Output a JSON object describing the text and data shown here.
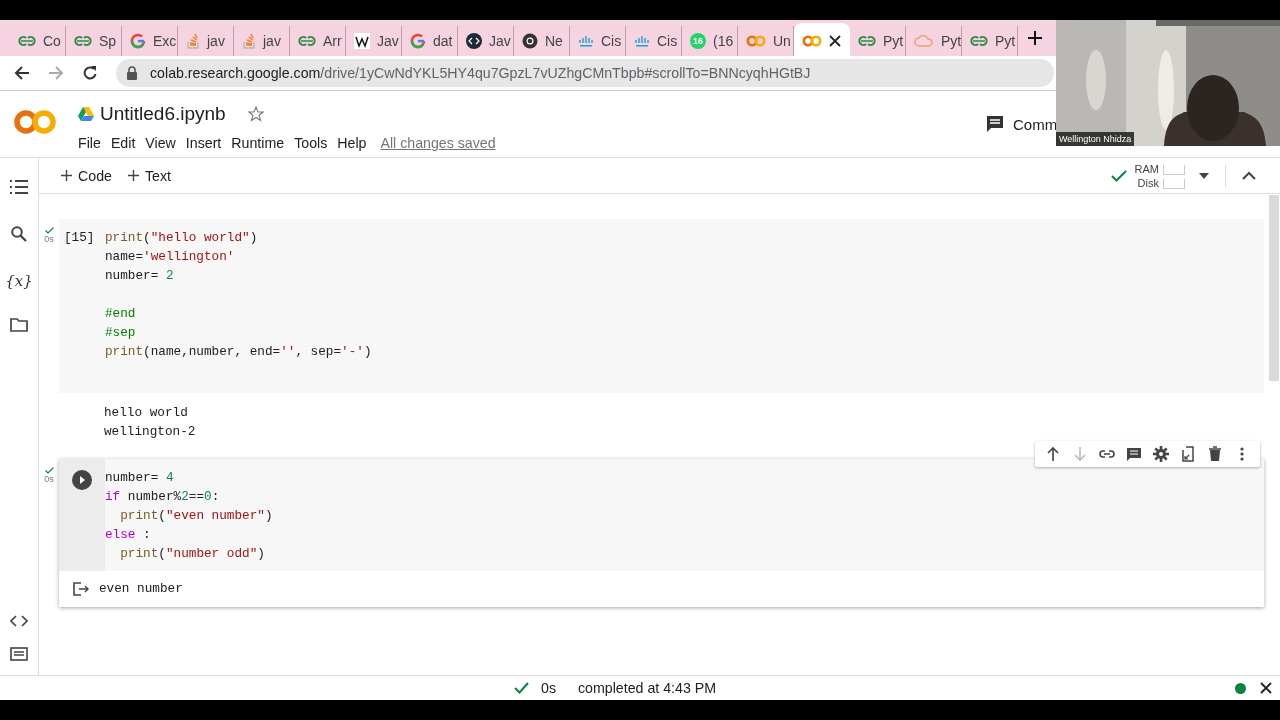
{
  "browser": {
    "tabs": [
      {
        "kind": "gfg",
        "label": "Co",
        "selected": false
      },
      {
        "kind": "gfg",
        "label": "Sp",
        "selected": false
      },
      {
        "kind": "google",
        "label": "Exc",
        "selected": false
      },
      {
        "kind": "stack",
        "label": "jav",
        "selected": false
      },
      {
        "kind": "stack",
        "label": "jav",
        "selected": false
      },
      {
        "kind": "gfg",
        "label": "Arr",
        "selected": false
      },
      {
        "kind": "wiki",
        "label": "Jav",
        "selected": false
      },
      {
        "kind": "google",
        "label": "dat",
        "selected": false
      },
      {
        "kind": "code",
        "label": "Jav",
        "selected": false
      },
      {
        "kind": "chrome",
        "label": "Ne",
        "selected": false
      },
      {
        "kind": "cisco",
        "label": "Cis",
        "selected": false
      },
      {
        "kind": "cisco",
        "label": "Cis",
        "selected": false
      },
      {
        "kind": "chat",
        "badge": "16",
        "label": "(16",
        "selected": false
      },
      {
        "kind": "colab",
        "label": "Un",
        "selected": false
      },
      {
        "kind": "colab",
        "selected": true
      },
      {
        "kind": "gfg",
        "label": "Pyt",
        "selected": false
      },
      {
        "kind": "cloud",
        "label": "Pyt",
        "selected": false
      },
      {
        "kind": "gfg",
        "label": "Pyt",
        "selected": false
      }
    ],
    "address": {
      "host": "colab.research.google.com",
      "path": "/drive/1yCwNdYKL5HY4qu7GpzL7vUZhgCMnTbpb#scrollTo=BNNcyqhHGtBJ"
    }
  },
  "notebook": {
    "title": "Untitled6.ipynb",
    "menus": [
      "File",
      "Edit",
      "View",
      "Insert",
      "Runtime",
      "Tools",
      "Help"
    ],
    "save_status": "All changes saved",
    "comment_label": "Comm"
  },
  "toolbar": {
    "add_buttons": [
      "Code",
      "Text"
    ],
    "resources": [
      "RAM",
      "Disk"
    ]
  },
  "sidebar": {
    "top": [
      {
        "kind": "toc"
      },
      {
        "kind": "search"
      },
      {
        "kind": "variables",
        "glyph": "{x}"
      },
      {
        "kind": "files"
      }
    ],
    "bottom": [
      {
        "kind": "snippets"
      },
      {
        "kind": "terminal"
      }
    ]
  },
  "cells": [
    {
      "focused": false,
      "exec_count": "[15]",
      "run_time": "0s",
      "lines": [
        {
          "kind": "code",
          "indented": false,
          "tokens": [
            {
              "kind": "fn",
              "text": "print"
            },
            {
              "kind": "plain",
              "text": "("
            },
            {
              "kind": "str",
              "text": "\"hello world\""
            },
            {
              "kind": "plain",
              "text": ")"
            }
          ]
        },
        {
          "kind": "code",
          "indented": false,
          "tokens": [
            {
              "kind": "plain",
              "text": "name="
            },
            {
              "kind": "str",
              "text": "'wellington'"
            }
          ]
        },
        {
          "kind": "code",
          "indented": false,
          "tokens": [
            {
              "kind": "plain",
              "text": "number= "
            },
            {
              "kind": "num",
              "text": "2"
            }
          ]
        },
        {
          "kind": "blank"
        },
        {
          "kind": "code",
          "indented": false,
          "tokens": [
            {
              "kind": "comment",
              "text": "#end"
            }
          ]
        },
        {
          "kind": "code",
          "indented": false,
          "tokens": [
            {
              "kind": "comment",
              "text": "#sep"
            }
          ]
        },
        {
          "kind": "code",
          "indented": false,
          "tokens": [
            {
              "kind": "fn",
              "text": "print"
            },
            {
              "kind": "plain",
              "text": "(name,number, end="
            },
            {
              "kind": "str",
              "text": "''"
            },
            {
              "kind": "plain",
              "text": ", sep="
            },
            {
              "kind": "str",
              "text": "'-'"
            },
            {
              "kind": "plain",
              "text": ")"
            }
          ]
        }
      ],
      "output": [
        "hello world",
        "wellington-2"
      ]
    },
    {
      "focused": true,
      "run_time": "0s",
      "lines": [
        {
          "kind": "code",
          "indented": false,
          "tokens": [
            {
              "kind": "plain",
              "text": "number= "
            },
            {
              "kind": "num",
              "text": "4"
            }
          ]
        },
        {
          "kind": "code",
          "indented": false,
          "tokens": [
            {
              "kind": "kw",
              "text": "if"
            },
            {
              "kind": "plain",
              "text": " number%"
            },
            {
              "kind": "num",
              "text": "2"
            },
            {
              "kind": "plain",
              "text": "=="
            },
            {
              "kind": "num",
              "text": "0"
            },
            {
              "kind": "plain",
              "text": ":"
            }
          ]
        },
        {
          "kind": "code",
          "indented": true,
          "tokens": [
            {
              "kind": "fn",
              "text": "print"
            },
            {
              "kind": "plain",
              "text": "("
            },
            {
              "kind": "str",
              "text": "\"even number\""
            },
            {
              "kind": "plain",
              "text": ")"
            }
          ]
        },
        {
          "kind": "code",
          "indented": false,
          "tokens": [
            {
              "kind": "kw",
              "text": "else"
            },
            {
              "kind": "plain",
              "text": " :"
            }
          ]
        },
        {
          "kind": "code",
          "indented": true,
          "tokens": [
            {
              "kind": "fn",
              "text": "print"
            },
            {
              "kind": "plain",
              "text": "("
            },
            {
              "kind": "str",
              "text": "\"number odd\""
            },
            {
              "kind": "plain",
              "text": ")"
            }
          ]
        }
      ],
      "output": [
        "even number"
      ]
    }
  ],
  "status_bar": {
    "time": "0s",
    "message": "completed at 4:43 PM"
  },
  "video": {
    "name": "Wellington Nhidza"
  }
}
